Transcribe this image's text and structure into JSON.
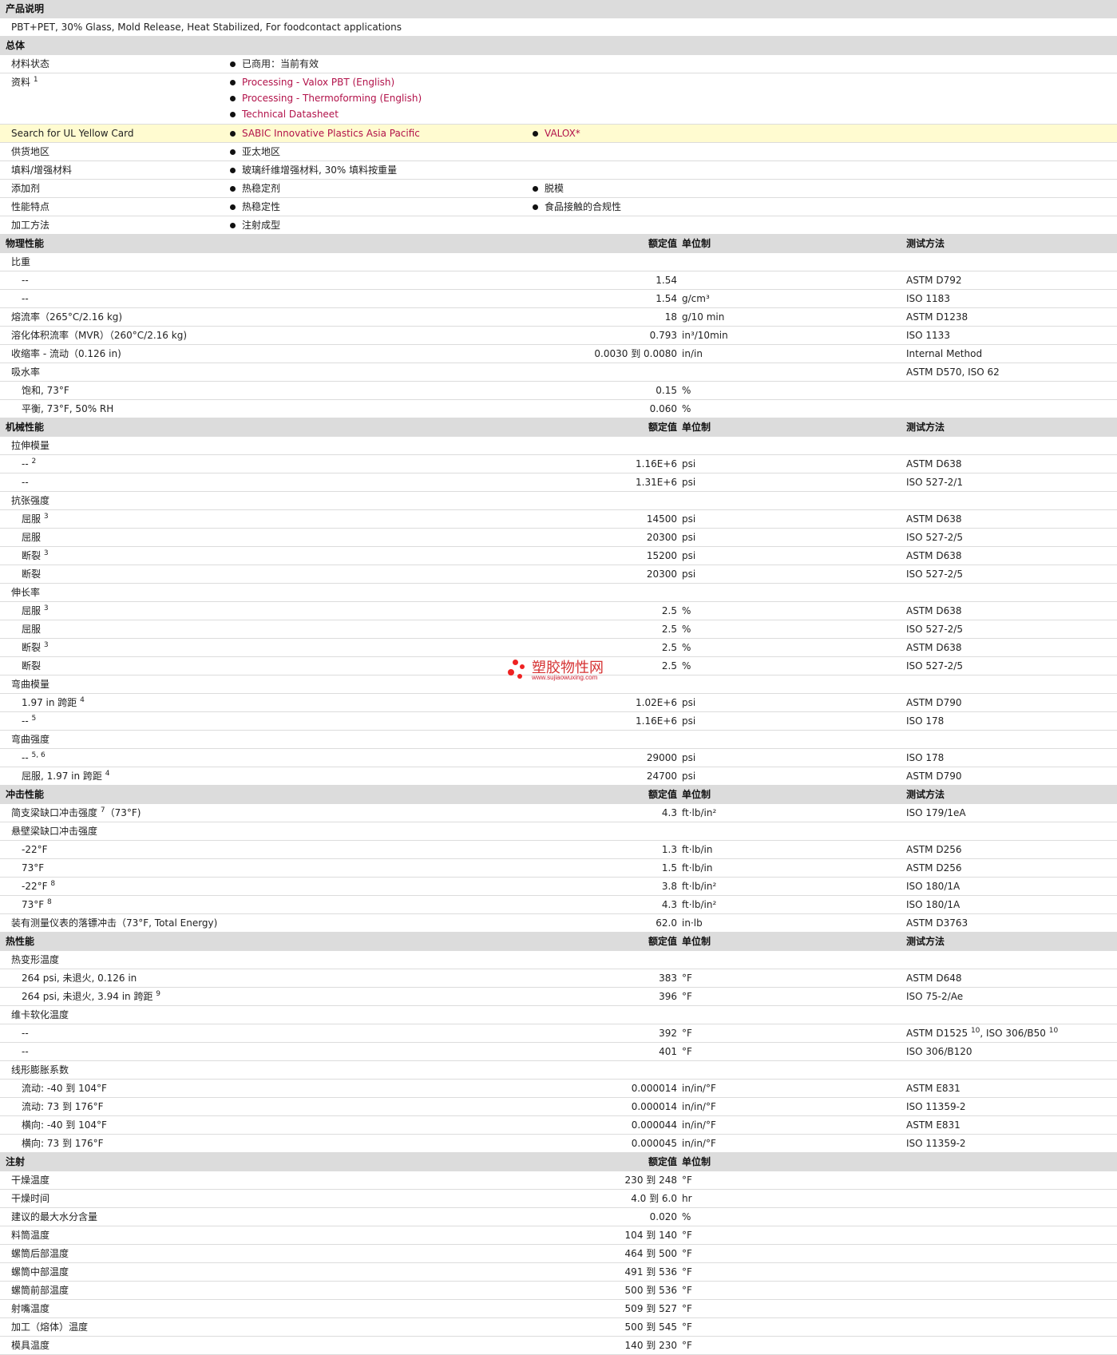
{
  "product": {
    "heading": "产品说明",
    "description": "PBT+PET, 30% Glass, Mold Release, Heat Stabilized, For foodcontact applications"
  },
  "general": {
    "heading": "总体",
    "material_status": {
      "label": "材料状态",
      "value": "已商用：当前有效"
    },
    "documents": {
      "label": "资料",
      "sup": "1",
      "items": [
        "Processing - Valox PBT (English)",
        "Processing - Thermoforming (English)",
        "Technical Datasheet"
      ]
    },
    "ul": {
      "label": "Search for UL Yellow Card",
      "items": [
        "SABIC Innovative Plastics Asia Pacific",
        "VALOX*"
      ]
    },
    "supply": {
      "label": "供货地区",
      "items": [
        "亚太地区"
      ]
    },
    "filler": {
      "label": "填料/增强材料",
      "items": [
        "玻璃纤维增强材料, 30% 填料按重量"
      ]
    },
    "additive": {
      "label": "添加剂",
      "items": [
        "热稳定剂",
        "脱模"
      ]
    },
    "features": {
      "label": "性能特点",
      "items": [
        "热稳定性",
        "食品接触的合规性"
      ]
    },
    "processing": {
      "label": "加工方法",
      "items": [
        "注射成型"
      ]
    }
  },
  "col_headers": {
    "rated": "额定值",
    "unit": "单位制",
    "test": "测试方法"
  },
  "sections": [
    {
      "heading": "物理性能",
      "rows": [
        {
          "label": "比重",
          "lvl": 1
        },
        {
          "label": "--",
          "lvl": 2,
          "val": "1.54",
          "unit": "",
          "test": "ASTM D792"
        },
        {
          "label": "--",
          "lvl": 2,
          "val": "1.54",
          "unit": "g/cm³",
          "test": "ISO 1183"
        },
        {
          "label": "熔流率（265°C/2.16 kg)",
          "lvl": 1,
          "val": "18",
          "unit": "g/10 min",
          "test": "ASTM D1238"
        },
        {
          "label": "溶化体积流率（MVR）（260°C/2.16 kg)",
          "lvl": 1,
          "val": "0.793",
          "unit": "in³/10min",
          "test": "ISO 1133"
        },
        {
          "label": "收缩率 - 流动（0.126 in)",
          "lvl": 1,
          "val": "0.0030 到  0.0080",
          "unit": "in/in",
          "test": "Internal Method"
        },
        {
          "label": "吸水率",
          "lvl": 1,
          "test": "ASTM D570, ISO 62"
        },
        {
          "label": "饱和, 73°F",
          "lvl": 2,
          "val": "0.15",
          "unit": "%"
        },
        {
          "label": "平衡, 73°F, 50% RH",
          "lvl": 2,
          "val": "0.060",
          "unit": "%"
        }
      ]
    },
    {
      "heading": "机械性能",
      "rows": [
        {
          "label": "拉伸模量",
          "lvl": 1
        },
        {
          "label": "--",
          "sup": "2",
          "lvl": 2,
          "val": "1.16E+6",
          "unit": "psi",
          "test": "ASTM D638"
        },
        {
          "label": "--",
          "lvl": 2,
          "val": "1.31E+6",
          "unit": "psi",
          "test": "ISO 527-2/1"
        },
        {
          "label": "抗张强度",
          "lvl": 1
        },
        {
          "label": "屈服",
          "sup": "3",
          "lvl": 2,
          "val": "14500",
          "unit": "psi",
          "test": "ASTM D638"
        },
        {
          "label": "屈服",
          "lvl": 2,
          "val": "20300",
          "unit": "psi",
          "test": "ISO 527-2/5"
        },
        {
          "label": "断裂",
          "sup": "3",
          "lvl": 2,
          "val": "15200",
          "unit": "psi",
          "test": "ASTM D638"
        },
        {
          "label": "断裂",
          "lvl": 2,
          "val": "20300",
          "unit": "psi",
          "test": "ISO 527-2/5"
        },
        {
          "label": "伸长率",
          "lvl": 1
        },
        {
          "label": "屈服",
          "sup": "3",
          "lvl": 2,
          "val": "2.5",
          "unit": "%",
          "test": "ASTM D638"
        },
        {
          "label": "屈服",
          "lvl": 2,
          "val": "2.5",
          "unit": "%",
          "test": "ISO 527-2/5"
        },
        {
          "label": "断裂",
          "sup": "3",
          "lvl": 2,
          "val": "2.5",
          "unit": "%",
          "test": "ASTM D638"
        },
        {
          "label": "断裂",
          "lvl": 2,
          "val": "2.5",
          "unit": "%",
          "test": "ISO 527-2/5"
        },
        {
          "label": "弯曲模量",
          "lvl": 1
        },
        {
          "label": "1.97 in 跨距",
          "sup": "4",
          "lvl": 2,
          "val": "1.02E+6",
          "unit": "psi",
          "test": "ASTM D790"
        },
        {
          "label": "--",
          "sup": "5",
          "lvl": 2,
          "val": "1.16E+6",
          "unit": "psi",
          "test": "ISO 178"
        },
        {
          "label": "弯曲强度",
          "lvl": 1
        },
        {
          "label": "--",
          "sup": "5, 6",
          "lvl": 2,
          "val": "29000",
          "unit": "psi",
          "test": "ISO 178"
        },
        {
          "label": "屈服, 1.97 in 跨距",
          "sup": "4",
          "lvl": 2,
          "val": "24700",
          "unit": "psi",
          "test": "ASTM D790"
        }
      ]
    },
    {
      "heading": "冲击性能",
      "rows": [
        {
          "label": "简支梁缺口冲击强度",
          "sup": "7",
          "suffix": "（73°F)",
          "lvl": 1,
          "val": "4.3",
          "unit": "ft·lb/in²",
          "test": "ISO 179/1eA"
        },
        {
          "label": "悬壁梁缺口冲击强度",
          "lvl": 1
        },
        {
          "label": "-22°F",
          "lvl": 2,
          "val": "1.3",
          "unit": "ft·lb/in",
          "test": "ASTM D256"
        },
        {
          "label": "73°F",
          "lvl": 2,
          "val": "1.5",
          "unit": "ft·lb/in",
          "test": "ASTM D256"
        },
        {
          "label": "-22°F",
          "sup": "8",
          "lvl": 2,
          "val": "3.8",
          "unit": "ft·lb/in²",
          "test": "ISO 180/1A"
        },
        {
          "label": "73°F",
          "sup": "8",
          "lvl": 2,
          "val": "4.3",
          "unit": "ft·lb/in²",
          "test": "ISO 180/1A"
        },
        {
          "label": "装有测量仪表的落镖冲击（73°F, Total Energy)",
          "lvl": 1,
          "val": "62.0",
          "unit": "in·lb",
          "test": "ASTM D3763"
        }
      ]
    },
    {
      "heading": "热性能",
      "rows": [
        {
          "label": "热变形温度",
          "lvl": 1
        },
        {
          "label": "264 psi, 未退火, 0.126 in",
          "lvl": 2,
          "val": "383",
          "unit": "°F",
          "test": "ASTM D648"
        },
        {
          "label": "264 psi, 未退火, 3.94 in 跨距",
          "sup": "9",
          "lvl": 2,
          "val": "396",
          "unit": "°F",
          "test": "ISO 75-2/Ae"
        },
        {
          "label": "维卡软化温度",
          "lvl": 1
        },
        {
          "label": "--",
          "lvl": 2,
          "val": "392",
          "unit": "°F",
          "test": "ASTM D1525",
          "test_sup": "10",
          "test2": ", ISO 306/B50",
          "test2_sup": "10"
        },
        {
          "label": "--",
          "lvl": 2,
          "val": "401",
          "unit": "°F",
          "test": "ISO 306/B120"
        },
        {
          "label": "线形膨胀系数",
          "lvl": 1
        },
        {
          "label": "流动: -40 到  104°F",
          "lvl": 2,
          "val": "0.000014",
          "unit": "in/in/°F",
          "test": "ASTM E831"
        },
        {
          "label": "流动: 73 到  176°F",
          "lvl": 2,
          "val": "0.000014",
          "unit": "in/in/°F",
          "test": "ISO 11359-2"
        },
        {
          "label": "横向: -40 到  104°F",
          "lvl": 2,
          "val": "0.000044",
          "unit": "in/in/°F",
          "test": "ASTM E831"
        },
        {
          "label": "横向: 73 到  176°F",
          "lvl": 2,
          "val": "0.000045",
          "unit": "in/in/°F",
          "test": "ISO 11359-2"
        }
      ]
    },
    {
      "heading": "注射",
      "no_test": true,
      "rows": [
        {
          "label": "干燥温度",
          "lvl": 1,
          "val": "230 到  248",
          "unit": "°F"
        },
        {
          "label": "干燥时间",
          "lvl": 1,
          "val": "4.0 到  6.0",
          "unit": "hr"
        },
        {
          "label": "建议的最大水分含量",
          "lvl": 1,
          "val": "0.020",
          "unit": "%"
        },
        {
          "label": "料筒温度",
          "lvl": 1,
          "val": "104 到  140",
          "unit": "°F"
        },
        {
          "label": "螺筒后部温度",
          "lvl": 1,
          "val": "464 到  500",
          "unit": "°F"
        },
        {
          "label": "螺筒中部温度",
          "lvl": 1,
          "val": "491 到  536",
          "unit": "°F"
        },
        {
          "label": "螺筒前部温度",
          "lvl": 1,
          "val": "500 到  536",
          "unit": "°F"
        },
        {
          "label": "射嘴温度",
          "lvl": 1,
          "val": "509 到  527",
          "unit": "°F"
        },
        {
          "label": "加工（熔体）温度",
          "lvl": 1,
          "val": "500 到  545",
          "unit": "°F"
        },
        {
          "label": "模具温度",
          "lvl": 1,
          "val": "140 到  230",
          "unit": "°F"
        }
      ]
    }
  ],
  "watermark": {
    "text": "塑胶物性网",
    "sub": "www.sujiaowuxing.com"
  },
  "colors": {
    "section_bg": "#dcdcdc",
    "link": "#b2124a",
    "highlight": "#fffbd0",
    "watermark": "#d63333"
  }
}
